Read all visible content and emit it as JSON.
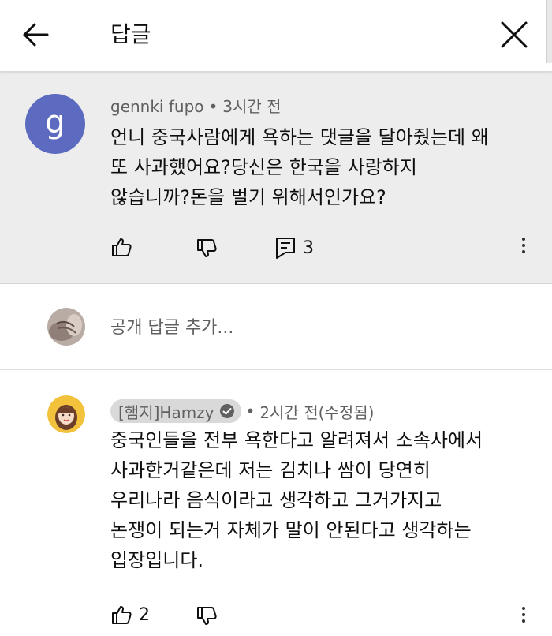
{
  "header": {
    "title": "답글"
  },
  "comment": {
    "avatar_letter": "g",
    "avatar_color": "#5c6bc0",
    "author": "gennki fupo",
    "time": "3시간 전",
    "lines": [
      "언니 중국사람에게 욕하는 댓글을 달아줬는데 왜",
      "또 사과했어요?당신은 한국을 사랑하지",
      "않습니까?돈을 벌기 위해서인가요?"
    ],
    "reply_count": "3"
  },
  "reply_box": {
    "placeholder": "공개 답글 추가..."
  },
  "reply": {
    "author": "[햄지]Hamzy",
    "time": "2시간 전(수정됨)",
    "lines": [
      "중국인들을 전부 욕한다고 알려져서 소속사에서",
      "사과한거같은데 저는 김치나 쌈이 당연히",
      "우리나라 음식이라고 생각하고 그거가지고",
      "논쟁이 되는거 자체가 말이 안된다고 생각하는",
      "입장입니다."
    ],
    "like_count": "2"
  },
  "colors": {
    "header_bg": "#ffffff",
    "highlight_bg": "#ededed",
    "secondary_text": "#606060",
    "chip_bg": "#d9d9d9"
  },
  "icons": [
    "arrow-back-icon",
    "close-icon",
    "thumbs-up-icon",
    "thumbs-down-icon",
    "reply-icon",
    "more-vert-icon",
    "verified-icon"
  ]
}
